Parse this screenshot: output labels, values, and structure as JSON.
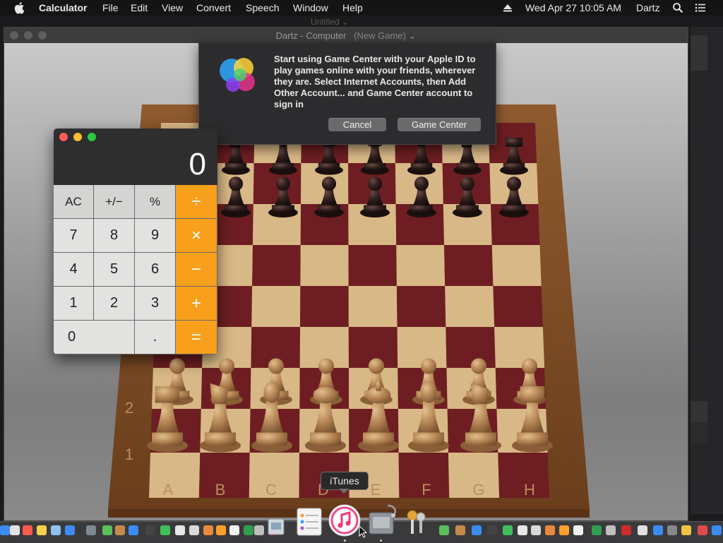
{
  "menubar": {
    "app_name": "Calculator",
    "menus": [
      "File",
      "Edit",
      "View",
      "Convert",
      "Speech",
      "Window",
      "Help"
    ],
    "clock": "Wed Apr 27  10:05 AM",
    "user": "Dartz",
    "icons": [
      "apple-icon",
      "eject-icon",
      "spotlight-icon",
      "notification-center-icon"
    ]
  },
  "background_window": {
    "title": "Untitled"
  },
  "chess_window": {
    "title": "Dartz - Computer",
    "subtitle": "(New Game)",
    "files": [
      "A",
      "B",
      "C",
      "D",
      "E",
      "F",
      "G",
      "H"
    ],
    "ranks": [
      "1",
      "2"
    ],
    "board_light": "#d9b887",
    "board_dark": "#6e1e22",
    "frame_color": "#7a4a24"
  },
  "game_center_dialog": {
    "message": "Start using Game Center with your Apple ID to play games online with your friends, wherever they are. Select Internet Accounts, then Add Other Account... and Game Center account to sign in",
    "cancel_label": "Cancel",
    "confirm_label": "Game Center"
  },
  "calculator": {
    "display": "0",
    "keys": {
      "ac": "AC",
      "sign": "+/−",
      "percent": "%",
      "divide": "÷",
      "seven": "7",
      "eight": "8",
      "nine": "9",
      "multiply": "×",
      "four": "4",
      "five": "5",
      "six": "6",
      "minus": "−",
      "one": "1",
      "two": "2",
      "three": "3",
      "plus": "+",
      "zero": "0",
      "decimal": ".",
      "equals": "="
    },
    "accent": "#f89f1b"
  },
  "dock": {
    "tooltip": "iTunes"
  }
}
